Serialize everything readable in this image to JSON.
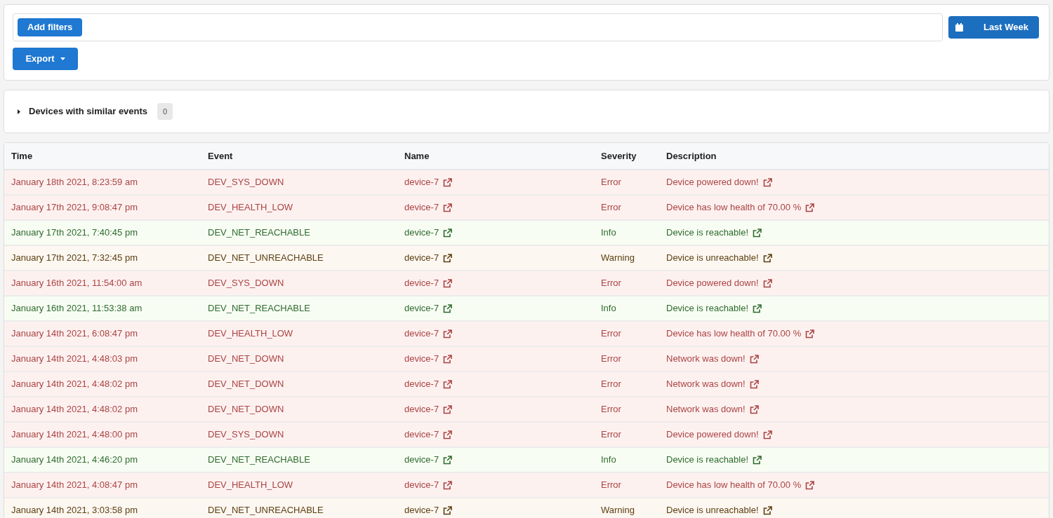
{
  "toolbar": {
    "add_filters": "Add filters",
    "date_range": "Last Week",
    "export": "Export"
  },
  "similar_devices": {
    "label": "Devices with similar events",
    "count": "0",
    "expanded": false
  },
  "table": {
    "columns": [
      "Time",
      "Event",
      "Name",
      "Severity",
      "Description"
    ],
    "rows": [
      {
        "kind": "error",
        "time": "January 18th 2021, 8:23:59 am",
        "event": "DEV_SYS_DOWN",
        "name": "device-7",
        "severity": "Error",
        "description": "Device powered down!"
      },
      {
        "kind": "error",
        "time": "January 17th 2021, 9:08:47 pm",
        "event": "DEV_HEALTH_LOW",
        "name": "device-7",
        "severity": "Error",
        "description": "Device has low health of 70.00 %"
      },
      {
        "kind": "info",
        "time": "January 17th 2021, 7:40:45 pm",
        "event": "DEV_NET_REACHABLE",
        "name": "device-7",
        "severity": "Info",
        "description": "Device is reachable!"
      },
      {
        "kind": "warning",
        "time": "January 17th 2021, 7:32:45 pm",
        "event": "DEV_NET_UNREACHABLE",
        "name": "device-7",
        "severity": "Warning",
        "description": "Device is unreachable!"
      },
      {
        "kind": "error",
        "time": "January 16th 2021, 11:54:00 am",
        "event": "DEV_SYS_DOWN",
        "name": "device-7",
        "severity": "Error",
        "description": "Device powered down!"
      },
      {
        "kind": "info",
        "time": "January 16th 2021, 11:53:38 am",
        "event": "DEV_NET_REACHABLE",
        "name": "device-7",
        "severity": "Info",
        "description": "Device is reachable!"
      },
      {
        "kind": "error",
        "time": "January 14th 2021, 6:08:47 pm",
        "event": "DEV_HEALTH_LOW",
        "name": "device-7",
        "severity": "Error",
        "description": "Device has low health of 70.00 %"
      },
      {
        "kind": "error",
        "time": "January 14th 2021, 4:48:03 pm",
        "event": "DEV_NET_DOWN",
        "name": "device-7",
        "severity": "Error",
        "description": "Network was down!"
      },
      {
        "kind": "error",
        "time": "January 14th 2021, 4:48:02 pm",
        "event": "DEV_NET_DOWN",
        "name": "device-7",
        "severity": "Error",
        "description": "Network was down!"
      },
      {
        "kind": "error",
        "time": "January 14th 2021, 4:48:02 pm",
        "event": "DEV_NET_DOWN",
        "name": "device-7",
        "severity": "Error",
        "description": "Network was down!"
      },
      {
        "kind": "error",
        "time": "January 14th 2021, 4:48:00 pm",
        "event": "DEV_SYS_DOWN",
        "name": "device-7",
        "severity": "Error",
        "description": "Device powered down!"
      },
      {
        "kind": "info",
        "time": "January 14th 2021, 4:46:20 pm",
        "event": "DEV_NET_REACHABLE",
        "name": "device-7",
        "severity": "Info",
        "description": "Device is reachable!"
      },
      {
        "kind": "error",
        "time": "January 14th 2021, 4:08:47 pm",
        "event": "DEV_HEALTH_LOW",
        "name": "device-7",
        "severity": "Error",
        "description": "Device has low health of 70.00 %"
      },
      {
        "kind": "warning",
        "time": "January 14th 2021, 3:03:58 pm",
        "event": "DEV_NET_UNREACHABLE",
        "name": "device-7",
        "severity": "Warning",
        "description": "Device is unreachable!"
      }
    ]
  }
}
